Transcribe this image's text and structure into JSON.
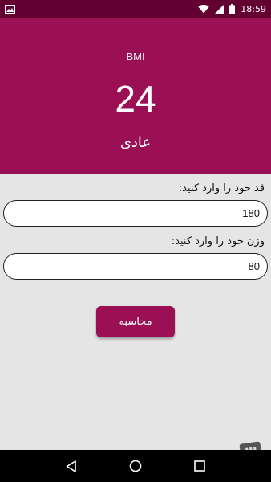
{
  "status_bar": {
    "time": "18:59",
    "icons": [
      "image-notification-icon",
      "wifi-icon",
      "signal-icon",
      "battery-icon"
    ]
  },
  "header": {
    "label": "BMI",
    "value": "24",
    "status": "عادی"
  },
  "form": {
    "height_label": "قد خود را وارد کنید:",
    "height_value": "180",
    "weight_label": "وزن خود را وارد کنید:",
    "weight_value": "80",
    "calc_button": "محاسبه"
  },
  "nav_bar": {
    "icons": [
      "back-icon",
      "home-icon",
      "recents-icon"
    ]
  },
  "colors": {
    "primary": "#9b0f54",
    "status_bar": "#620032",
    "background": "#e5e5e5",
    "nav_bar": "#000000"
  }
}
